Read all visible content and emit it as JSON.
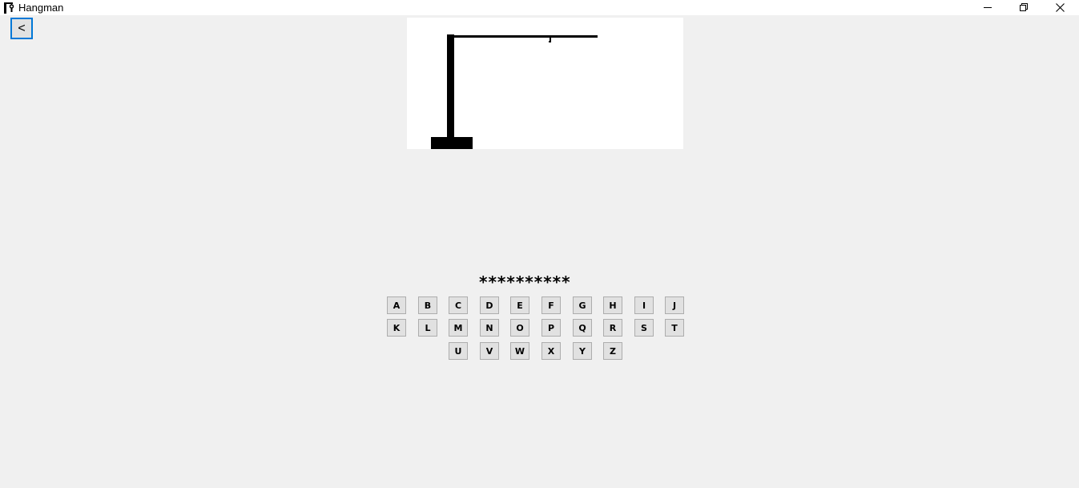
{
  "window": {
    "title": "Hangman",
    "minimize_icon": "minimize-icon",
    "maximize_icon": "restore-icon",
    "close_icon": "close-icon"
  },
  "toolbar": {
    "back_label": "<"
  },
  "game": {
    "masked_word": "**********",
    "stage": "rope",
    "colors": {
      "gallows": "#000000",
      "canvas": "#ffffff"
    }
  },
  "keyboard": {
    "row1": [
      "A",
      "B",
      "C",
      "D",
      "E",
      "F",
      "G",
      "H",
      "I",
      "J"
    ],
    "row2": [
      "K",
      "L",
      "M",
      "N",
      "O",
      "P",
      "Q",
      "R",
      "S",
      "T"
    ],
    "row3": [
      "U",
      "V",
      "W",
      "X",
      "Y",
      "Z"
    ]
  }
}
